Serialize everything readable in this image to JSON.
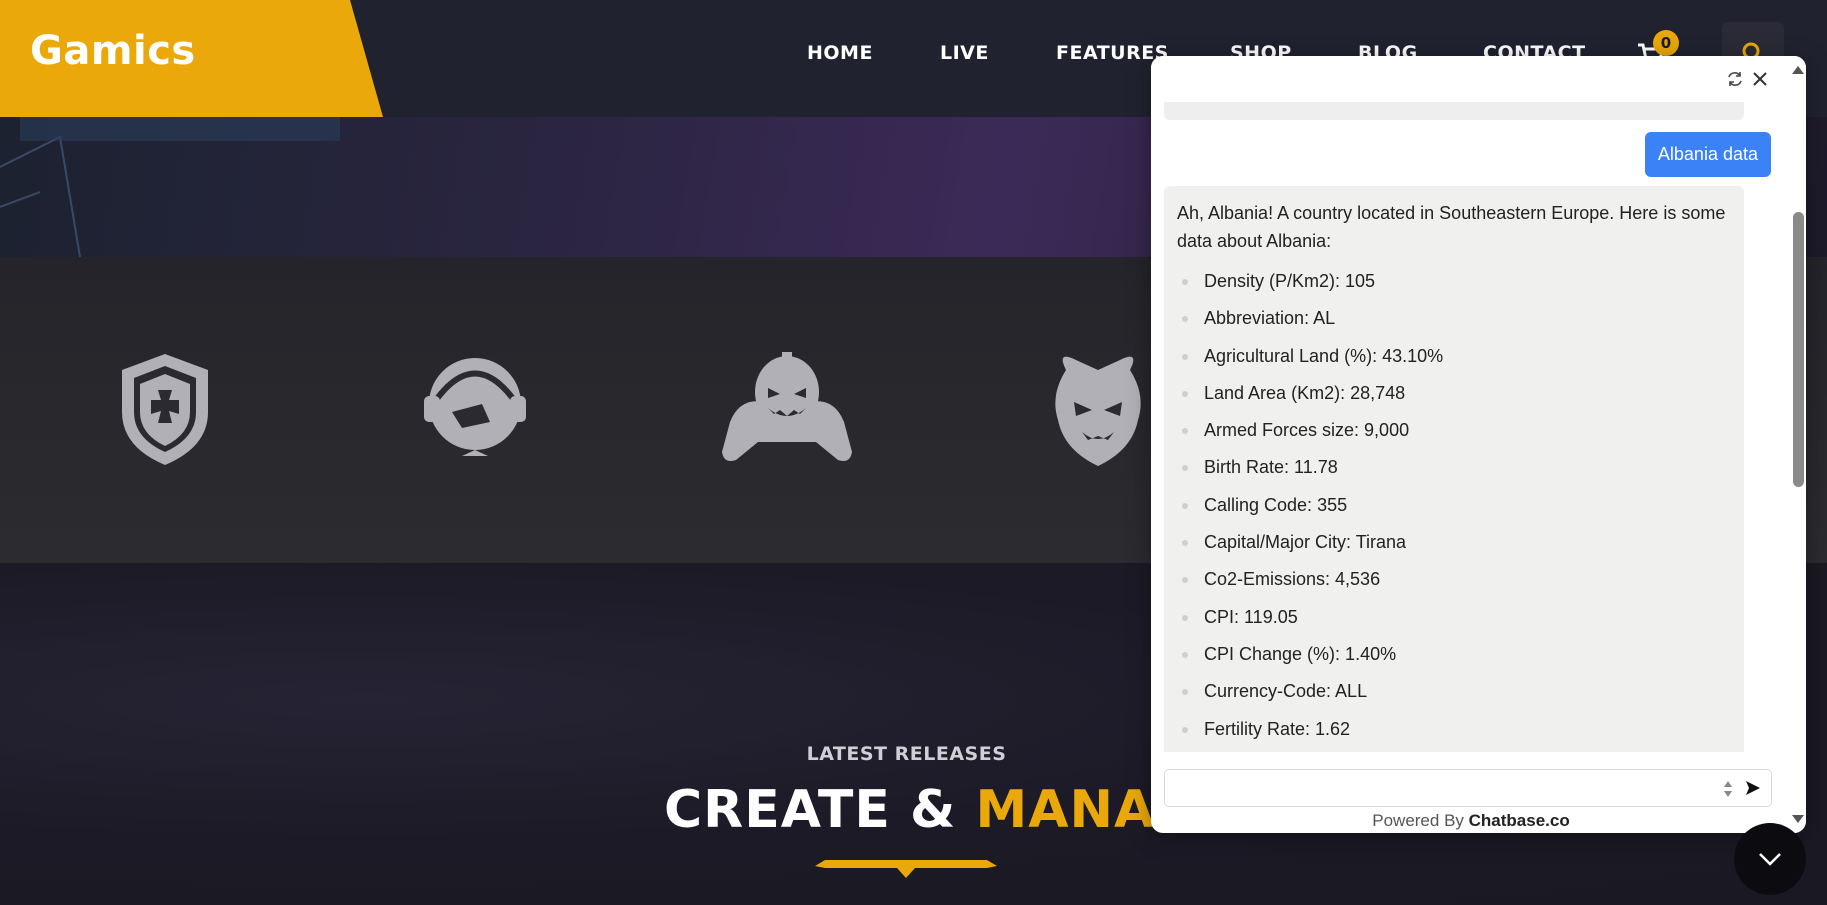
{
  "site": {
    "logo": "Gamics",
    "nav": [
      "HOME",
      "LIVE",
      "FEATURES",
      "SHOP",
      "BLOG",
      "CONTACT"
    ],
    "cart_count": "0",
    "accent": "#eaa80a"
  },
  "section": {
    "subtitle": "LATEST RELEASES",
    "title_white": "CREATE & ",
    "title_yellow": "MANAGE"
  },
  "partners": [
    "shield-cross-logo",
    "gamer-headset-logo",
    "pumpkin-controller-logo",
    "demon-head-logo"
  ],
  "chat": {
    "user_message": "Albania data",
    "bot_intro": "Ah, Albania! A country located in Southeastern Europe. Here is some data about Albania:",
    "bot_items": [
      "Density (P/Km2): 105",
      "Abbreviation: AL",
      "Agricultural Land (%): 43.10%",
      "Land Area (Km2): 28,748",
      "Armed Forces size: 9,000",
      "Birth Rate: 11.78",
      "Calling Code: 355",
      "Capital/Major City: Tirana",
      "Co2-Emissions: 4,536",
      "CPI: 119.05",
      "CPI Change (%): 1.40%",
      "Currency-Code: ALL",
      "Fertility Rate: 1.62"
    ],
    "input_placeholder": "",
    "powered_prefix": "Powered By ",
    "powered_brand": "Chatbase.co",
    "user_bubble_color": "#3b82f6"
  }
}
